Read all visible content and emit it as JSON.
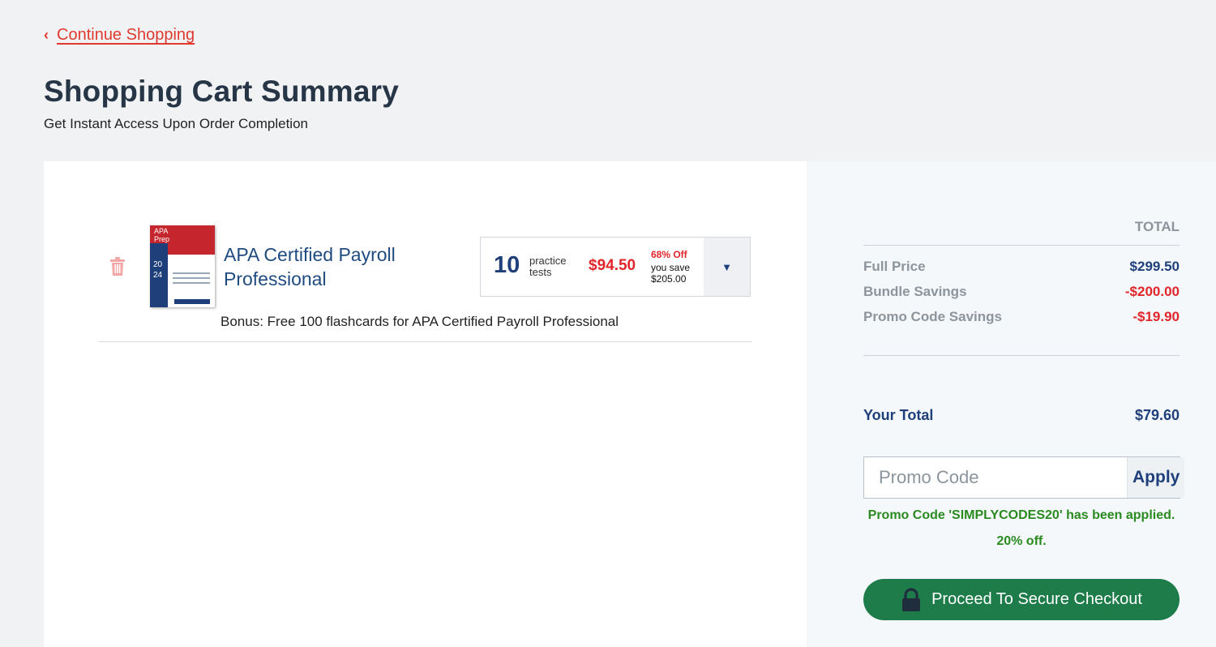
{
  "nav": {
    "continue_label": "Continue Shopping"
  },
  "header": {
    "title": "Shopping Cart Summary",
    "subtitle": "Get Instant Access Upon Order Completion"
  },
  "cart": {
    "item": {
      "book_label_line1": "APA",
      "book_label_line2": "Prep",
      "book_year_top": "20",
      "book_year_bottom": "24",
      "title": "APA Certified Payroll Professional",
      "option_qty": "10",
      "option_unit_line1": "practice",
      "option_unit_line2": "tests",
      "option_price": "$94.50",
      "option_discount": "68% Off",
      "option_save_line1": "you save",
      "option_save_line2": "$205.00",
      "bonus": "Bonus: Free 100 flashcards for APA Certified Payroll Professional"
    }
  },
  "summary": {
    "total_header": "TOTAL",
    "rows": [
      {
        "label": "Full Price",
        "value": "$299.50",
        "value_color": "#1f3f7a"
      },
      {
        "label": "Bundle Savings",
        "value": "-$200.00",
        "value_color": "#e0262a"
      },
      {
        "label": "Promo Code Savings",
        "value": "-$19.90",
        "value_color": "#e0262a"
      }
    ],
    "your_total_label": "Your Total",
    "your_total_value": "$79.60",
    "promo_placeholder": "Promo Code",
    "apply_label": "Apply",
    "promo_msg_line1": "Promo Code 'SIMPLYCODES20' has been applied.",
    "promo_msg_line2": "20% off.",
    "checkout_label": "Proceed To Secure Checkout"
  },
  "colors": {
    "accent_red": "#e03a2f",
    "brand_navy": "#1f3f7a",
    "success_green": "#2a8a1f",
    "checkout_green": "#1e7c4a"
  },
  "icons": [
    "chevron-left-icon",
    "trash-icon",
    "dropdown-arrow-icon",
    "lock-icon"
  ]
}
